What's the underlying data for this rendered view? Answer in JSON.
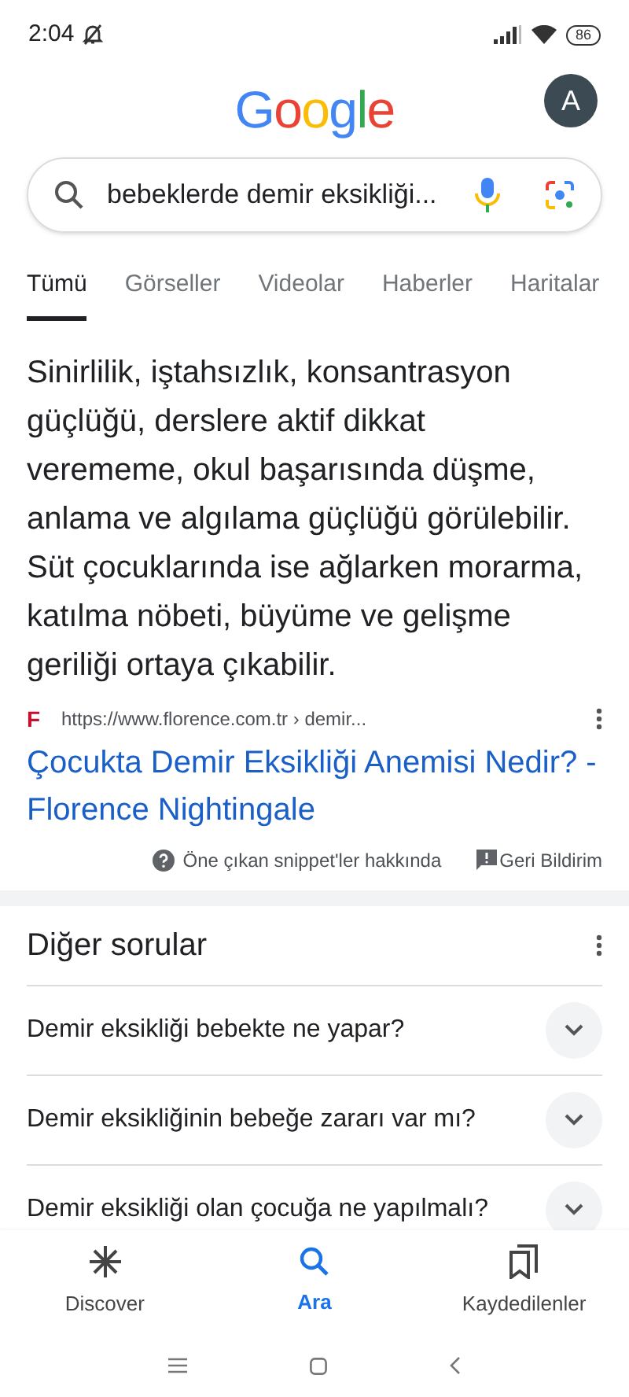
{
  "status_bar": {
    "time": "2:04",
    "battery": "86"
  },
  "header": {
    "logo": "Google",
    "avatar": "A"
  },
  "search": {
    "value": "bebeklerde demir eksikliği..."
  },
  "tabs": [
    {
      "label": "Tümü",
      "selected": true
    },
    {
      "label": "Görseller",
      "selected": false
    },
    {
      "label": "Videolar",
      "selected": false
    },
    {
      "label": "Haberler",
      "selected": false
    },
    {
      "label": "Haritalar",
      "selected": false
    }
  ],
  "snippet": {
    "text": "Sinirlilik, iştahsızlık, konsantrasyon güçlüğü, derslere aktif dikkat verememe, okul başarısında düşme, anlama ve algılama güçlüğü görülebilir. Süt çocuklarında ise ağlarken morarma, katılma nöbeti, büyüme ve gelişme geriliği ortaya çıkabilir.",
    "source_url": "https://www.florence.com.tr › demir...",
    "favicon": "F",
    "title": "Çocukta Demir Eksikliği Anemisi Nedir? - Florence Nightingale",
    "about": "Öne çıkan snippet'ler hakkında",
    "feedback": "Geri Bildirim"
  },
  "related_questions": {
    "title": "Diğer sorular",
    "items": [
      {
        "question": "Demir eksikliği bebekte ne yapar?",
        "expanded": false
      },
      {
        "question": "Demir eksikliğinin bebeğe zararı var mı?",
        "expanded": false
      },
      {
        "question": "Demir eksikliği olan çocuğa ne yapılmalı?",
        "expanded": false
      }
    ]
  },
  "bottom_nav": [
    {
      "label": "Discover",
      "kind": "discover",
      "selected": false
    },
    {
      "label": "Ara",
      "kind": "search",
      "selected": true
    },
    {
      "label": "Kaydedilenler",
      "kind": "saved",
      "selected": false
    }
  ]
}
